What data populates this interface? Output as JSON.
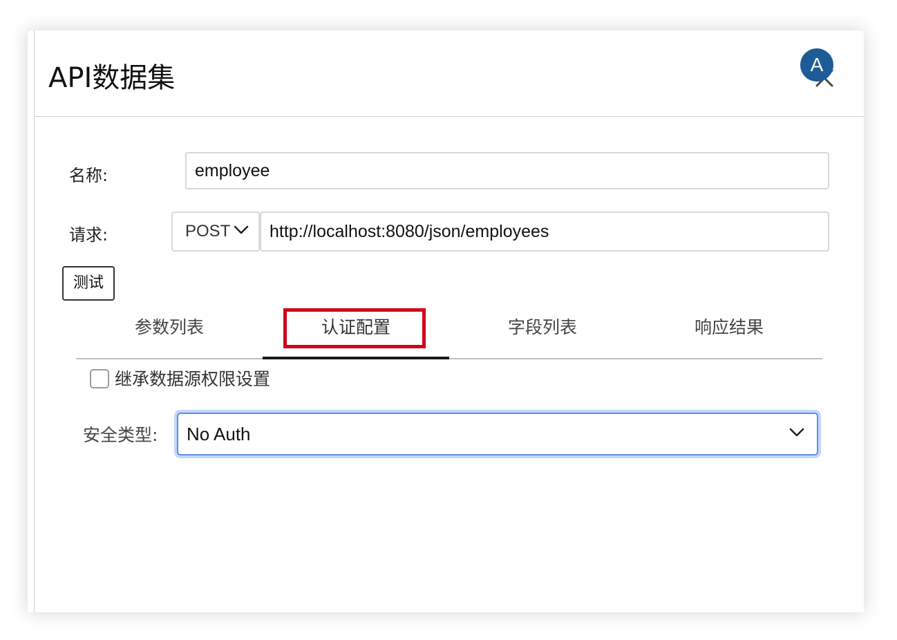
{
  "dialog": {
    "title": "API数据集",
    "avatar_letter": "A"
  },
  "form": {
    "name_label": "名称:",
    "name_value": "employee",
    "request_label": "请求:",
    "method": "POST",
    "url": "http://localhost:8080/json/employees",
    "test_button": "测试"
  },
  "tabs": [
    {
      "label": "参数列表",
      "active": false
    },
    {
      "label": "认证配置",
      "active": true
    },
    {
      "label": "字段列表",
      "active": false
    },
    {
      "label": "响应结果",
      "active": false
    }
  ],
  "auth": {
    "inherit_label": "继承数据源权限设置",
    "inherit_checked": false,
    "security_label": "安全类型:",
    "security_value": "No Auth"
  },
  "colors": {
    "avatar": "#1d5c97",
    "highlight": "#d0021b",
    "focus_border": "#5b8ee6"
  }
}
